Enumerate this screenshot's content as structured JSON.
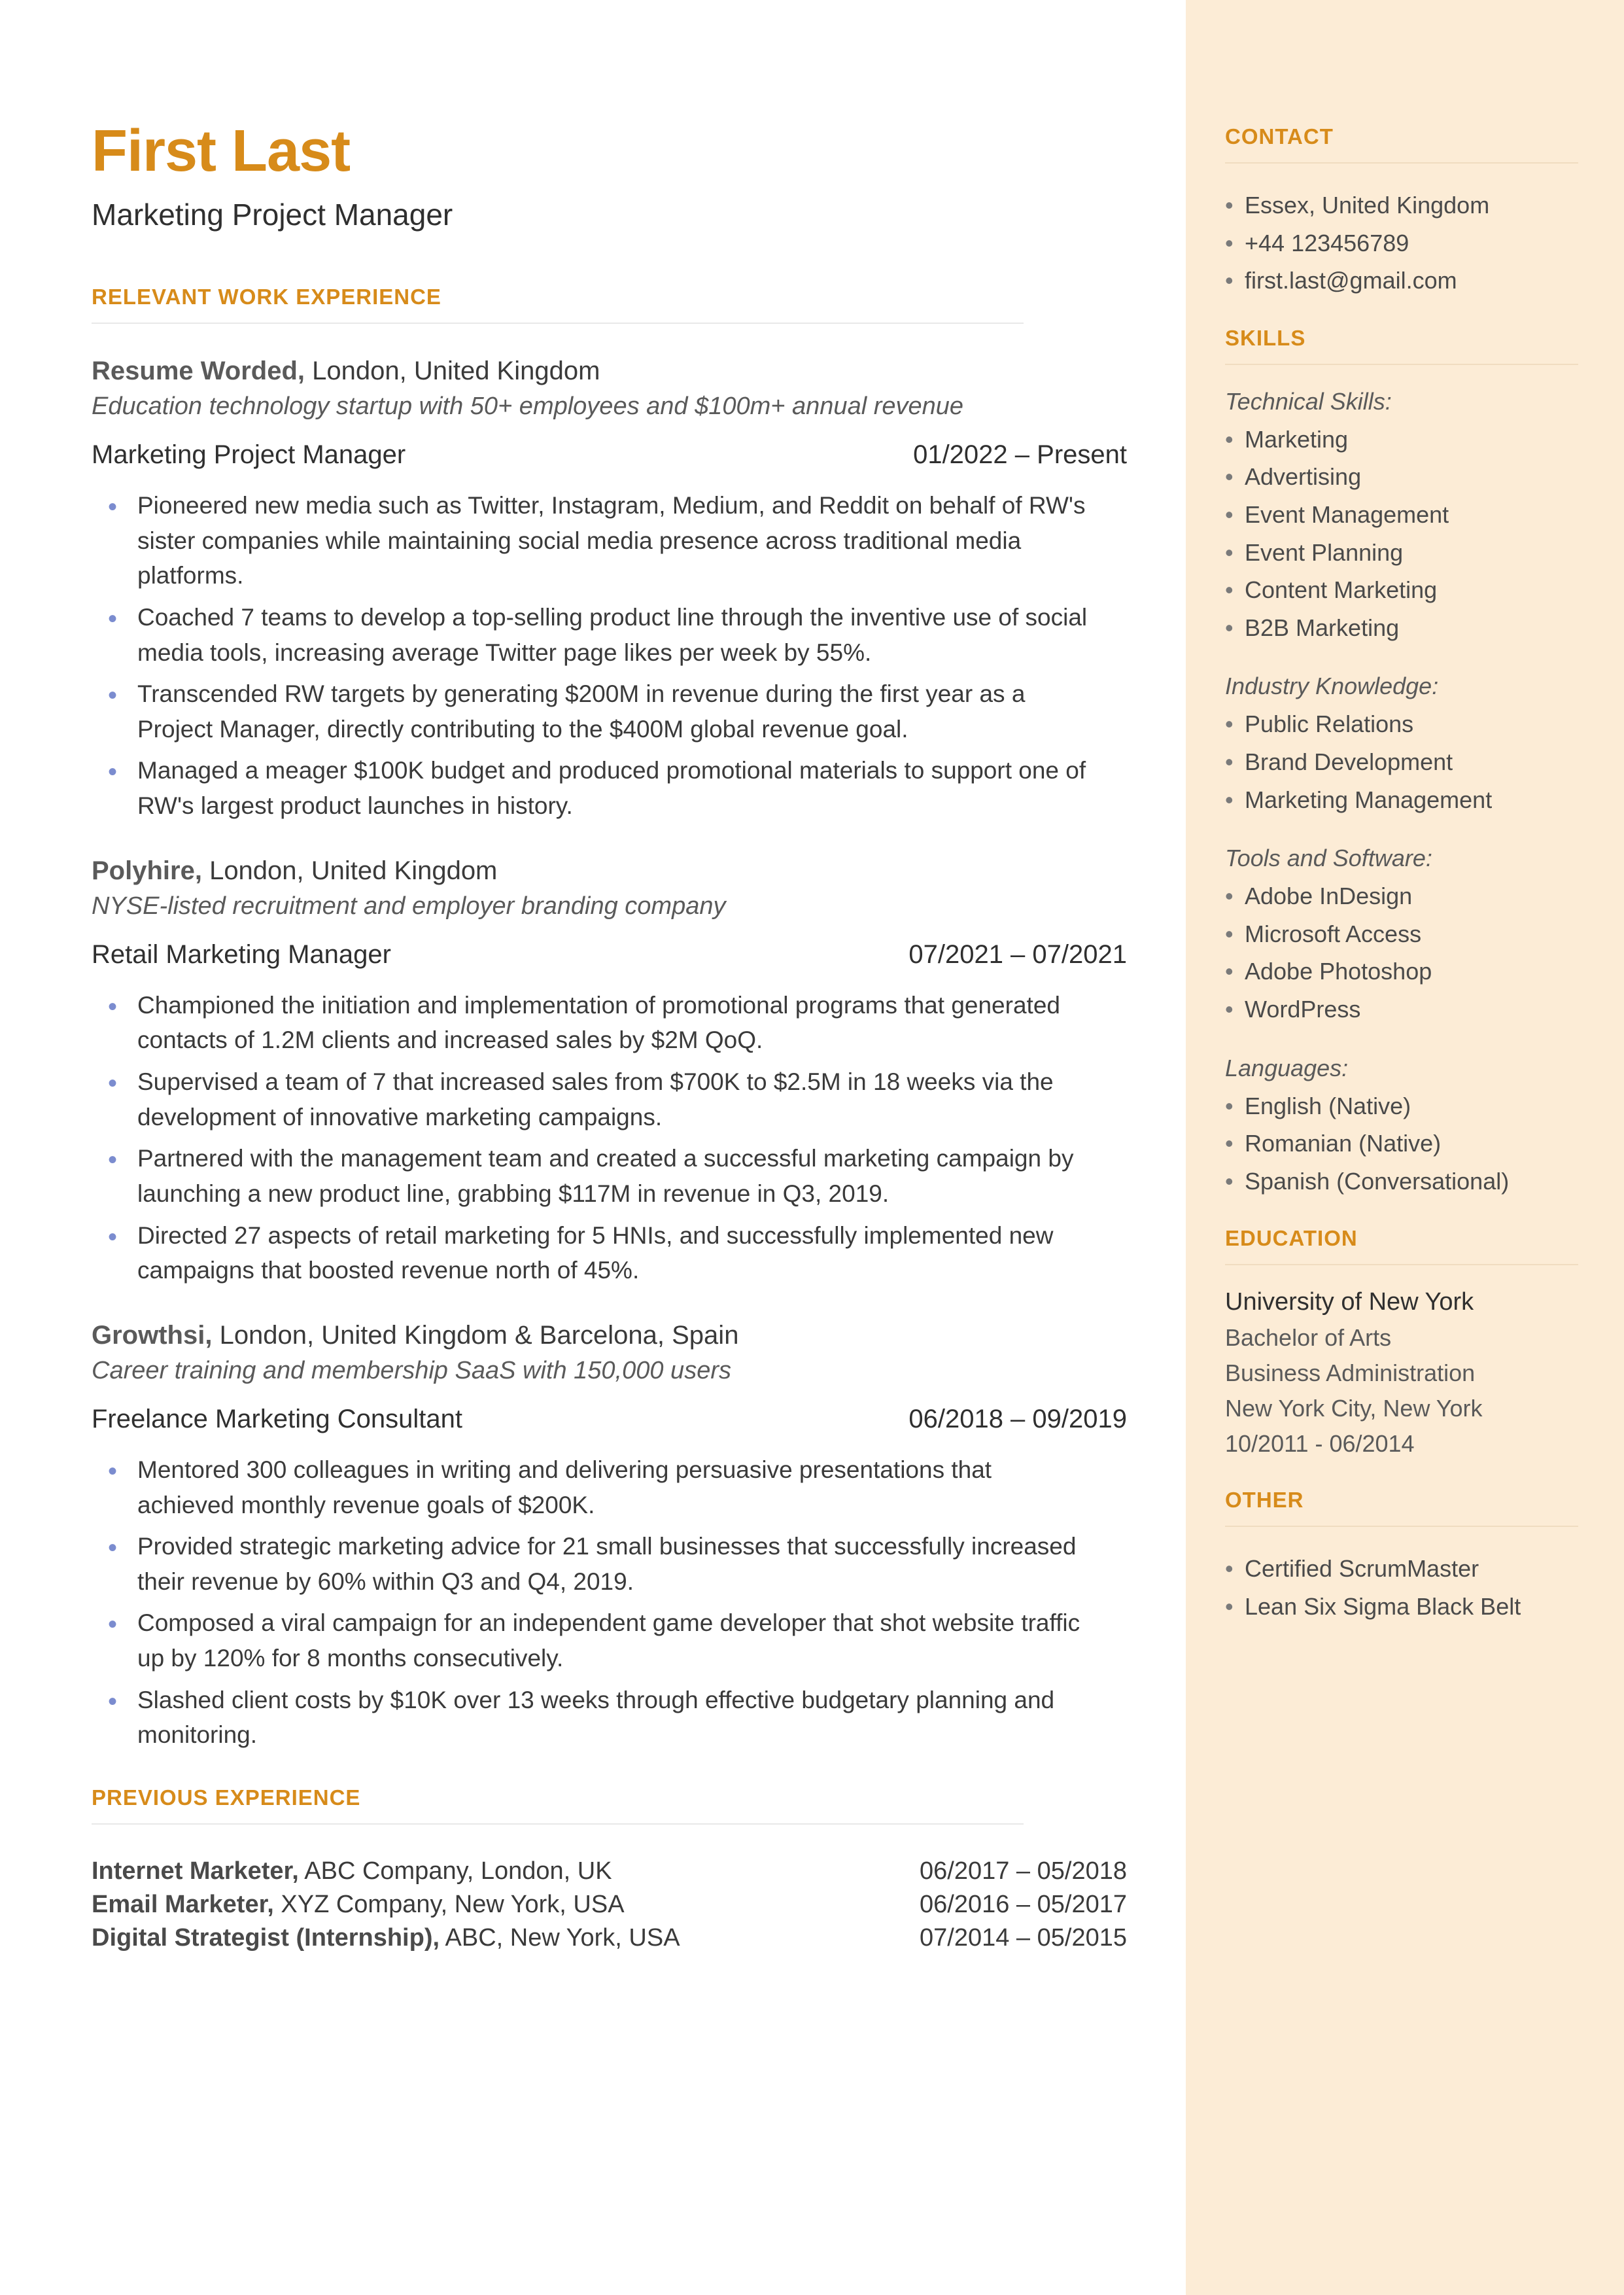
{
  "name": "First Last",
  "title": "Marketing Project Manager",
  "sections": {
    "relevant": "RELEVANT WORK EXPERIENCE",
    "previous": "PREVIOUS EXPERIENCE",
    "contact": "CONTACT",
    "skills": "SKILLS",
    "education": "EDUCATION",
    "other": "OTHER"
  },
  "jobs": [
    {
      "company": "Resume Worded,",
      "location": " London, United Kingdom",
      "desc": "Education technology startup with 50+ employees and $100m+ annual revenue",
      "role": "Marketing Project Manager",
      "dates": "01/2022 – Present",
      "bullets": [
        "Pioneered new media such as Twitter, Instagram, Medium, and Reddit on behalf of RW's sister companies while maintaining social media presence across traditional media platforms.",
        "Coached 7 teams to develop a top-selling product line through the inventive use of social media tools, increasing average Twitter page likes per week by 55%.",
        "Transcended RW targets by generating $200M in revenue during the first year as a Project Manager, directly contributing to the $400M global revenue goal.",
        "Managed a meager $100K budget and produced promotional materials to support one of RW's largest product launches in history."
      ]
    },
    {
      "company": "Polyhire,",
      "location": " London, United Kingdom",
      "desc": "NYSE-listed recruitment and employer branding company",
      "role": "Retail Marketing Manager",
      "dates": "07/2021 – 07/2021",
      "bullets": [
        "Championed the initiation and implementation of promotional programs that generated contacts of 1.2M clients and increased sales by $2M QoQ.",
        "Supervised a team of 7 that increased sales from $700K to $2.5M in 18 weeks via the development of innovative marketing campaigns.",
        "Partnered with the management team and created a successful marketing campaign by launching a new product line, grabbing $117M in revenue in Q3, 2019.",
        "Directed 27 aspects of retail marketing for 5 HNIs, and successfully implemented new campaigns that boosted revenue north of 45%."
      ]
    },
    {
      "company": "Growthsi,",
      "location": " London, United Kingdom & Barcelona, Spain",
      "desc": "Career training and membership SaaS with 150,000 users",
      "role": "Freelance Marketing Consultant",
      "dates": "06/2018 – 09/2019",
      "bullets": [
        "Mentored 300 colleagues in writing and delivering persuasive presentations that achieved monthly revenue goals of $200K.",
        "Provided strategic marketing advice for 21 small businesses that successfully increased their revenue by 60% within Q3 and Q4, 2019.",
        "Composed a viral campaign for an independent game developer that shot website traffic up by 120% for 8 months consecutively.",
        "Slashed client costs by $10K over 13 weeks through effective budgetary planning and monitoring."
      ]
    }
  ],
  "previous": [
    {
      "role": "Internet Marketer,",
      "co": " ABC Company, London, UK",
      "dates": "06/2017 – 05/2018"
    },
    {
      "role": "Email Marketer,",
      "co": " XYZ Company, New York, USA",
      "dates": "06/2016 – 05/2017"
    },
    {
      "role": "Digital Strategist (Internship),",
      "co": " ABC, New York, USA",
      "dates": "07/2014 – 05/2015"
    }
  ],
  "contact": [
    "Essex, United Kingdom",
    "+44 123456789",
    "first.last@gmail.com"
  ],
  "skills": {
    "cat1": "Technical Skills:",
    "list1": [
      "Marketing",
      "Advertising",
      "Event Management",
      "Event Planning",
      "Content Marketing",
      "B2B Marketing"
    ],
    "cat2": "Industry Knowledge:",
    "list2": [
      "Public Relations",
      "Brand Development",
      "Marketing Management"
    ],
    "cat3": "Tools and Software:",
    "list3": [
      "Adobe InDesign",
      "Microsoft Access",
      "Adobe Photoshop",
      "WordPress"
    ],
    "cat4": "Languages:",
    "list4": [
      "English (Native)",
      "Romanian (Native)",
      "Spanish (Conversational)"
    ]
  },
  "education": {
    "school": "University of New York",
    "degree": "Bachelor of Arts",
    "field": "Business Administration",
    "loc": "New York City, New York",
    "dates": "10/2011 - 06/2014"
  },
  "other": [
    "Certified ScrumMaster",
    "Lean Six Sigma Black Belt"
  ]
}
